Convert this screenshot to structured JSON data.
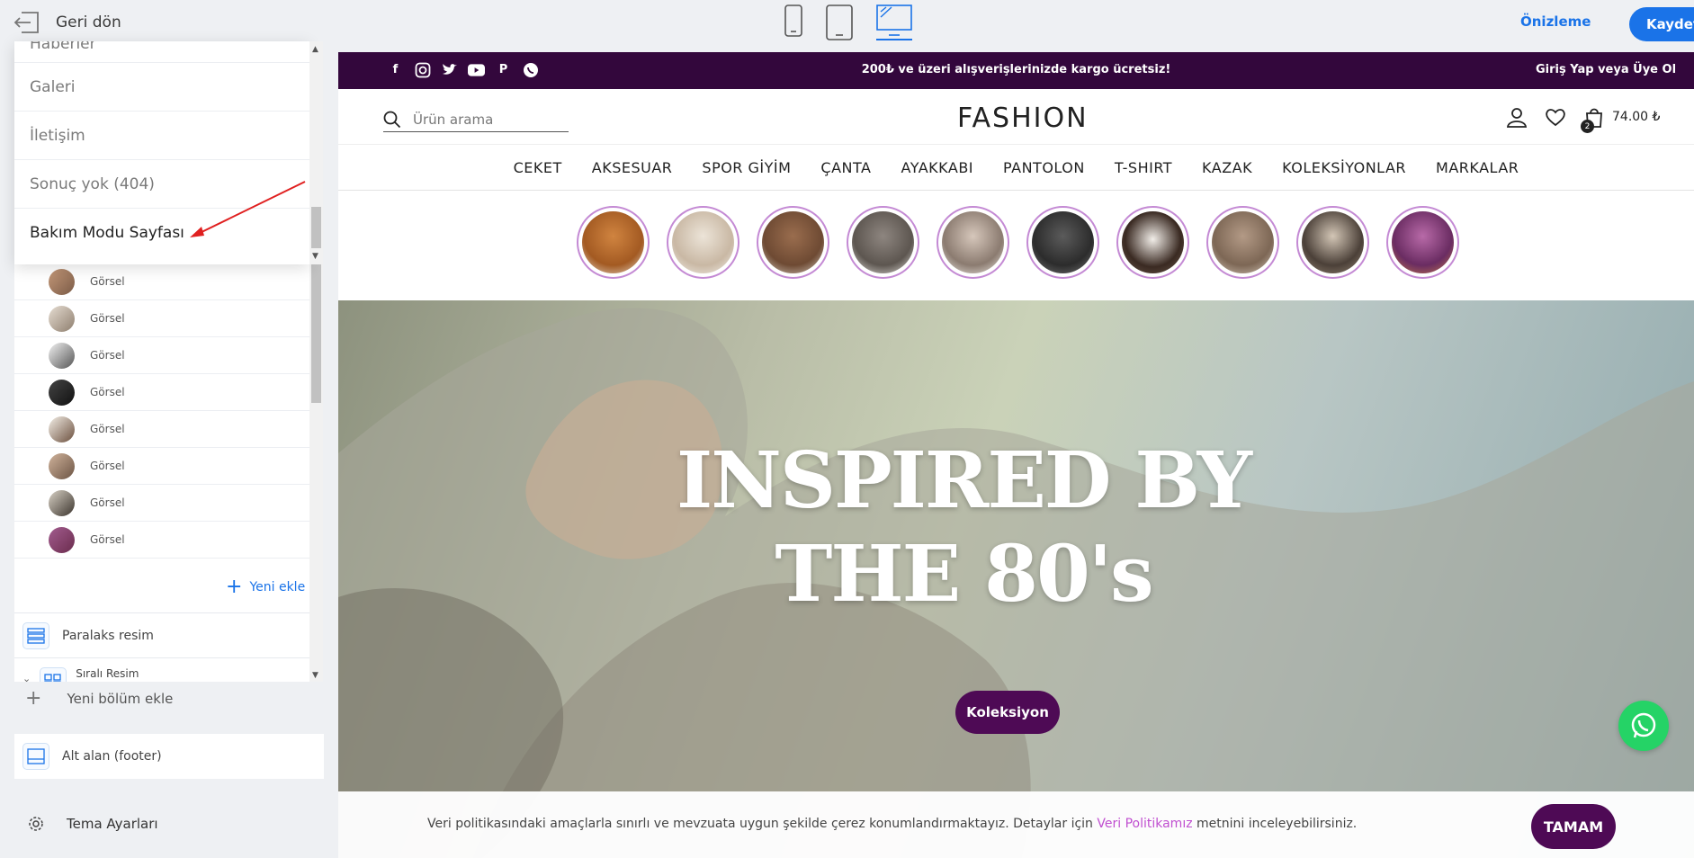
{
  "topbar": {
    "back_label": "Geri dön",
    "devices": [
      "mobile-icon",
      "tablet-icon",
      "desktop-icon"
    ],
    "active_device": "desktop",
    "preview_label": "Önizleme",
    "save_label": "Kaydet"
  },
  "dropdown": {
    "items": [
      "Haberler",
      "Galeri",
      "İletişim",
      "Sonuç yok (404)",
      "Bakım Modu Sayfası"
    ],
    "selected": "Bakım Modu Sayfası"
  },
  "sidebar": {
    "image_items": [
      "Görsel",
      "Görsel",
      "Görsel",
      "Görsel",
      "Görsel",
      "Görsel",
      "Görsel",
      "Görsel"
    ],
    "add_new": "Yeni ekle",
    "sections": [
      {
        "label": "Paralaks resim",
        "icon": "parallax-image-icon"
      },
      {
        "label": "Sıralı Resim",
        "icon": "grid-image-icon"
      }
    ],
    "new_section": "Yeni bölüm ekle",
    "footer_label": "Alt alan (footer)",
    "theme_settings": "Tema Ayarları"
  },
  "site": {
    "announcement": "200₺ ve üzeri alışverişlerinizde kargo ücretsiz!",
    "login": "Giriş Yap veya Üye Ol",
    "social": [
      "facebook-icon",
      "instagram-icon",
      "twitter-icon",
      "youtube-icon",
      "pinterest-icon",
      "whatsapp-icon"
    ],
    "search_placeholder": "Ürün arama",
    "logo": "FASHION",
    "cart_count": "2",
    "cart_price": "74.00 ₺",
    "nav": [
      "CEKET",
      "AKSESUAR",
      "SPOR GİYİM",
      "ÇANTA",
      "AYAKKABI",
      "PANTOLON",
      "T-SHIRT",
      "KAZAK",
      "KOLEKSİYONLAR",
      "MARKALAR"
    ],
    "story_count": 10,
    "hero": {
      "line1": "INSPIRED BY",
      "line2": "THE 80's",
      "button": "Koleksiyon"
    },
    "cookie": {
      "text_before": "Veri politikasındaki amaçlarla sınırlı ve mevzuata uygun şekilde çerez konumlandırmaktayız. Detaylar için ",
      "link": "Veri Politikamız",
      "text_after": " metnini inceleyebilirsiniz.",
      "ok": "TAMAM"
    }
  },
  "colors": {
    "accent": "#1a73e8",
    "brand_dark": "#33073c",
    "button_purple": "#4e0a55",
    "story_ring": "#c48ad4",
    "link_pink": "#c04fd0",
    "whatsapp": "#25d366"
  }
}
